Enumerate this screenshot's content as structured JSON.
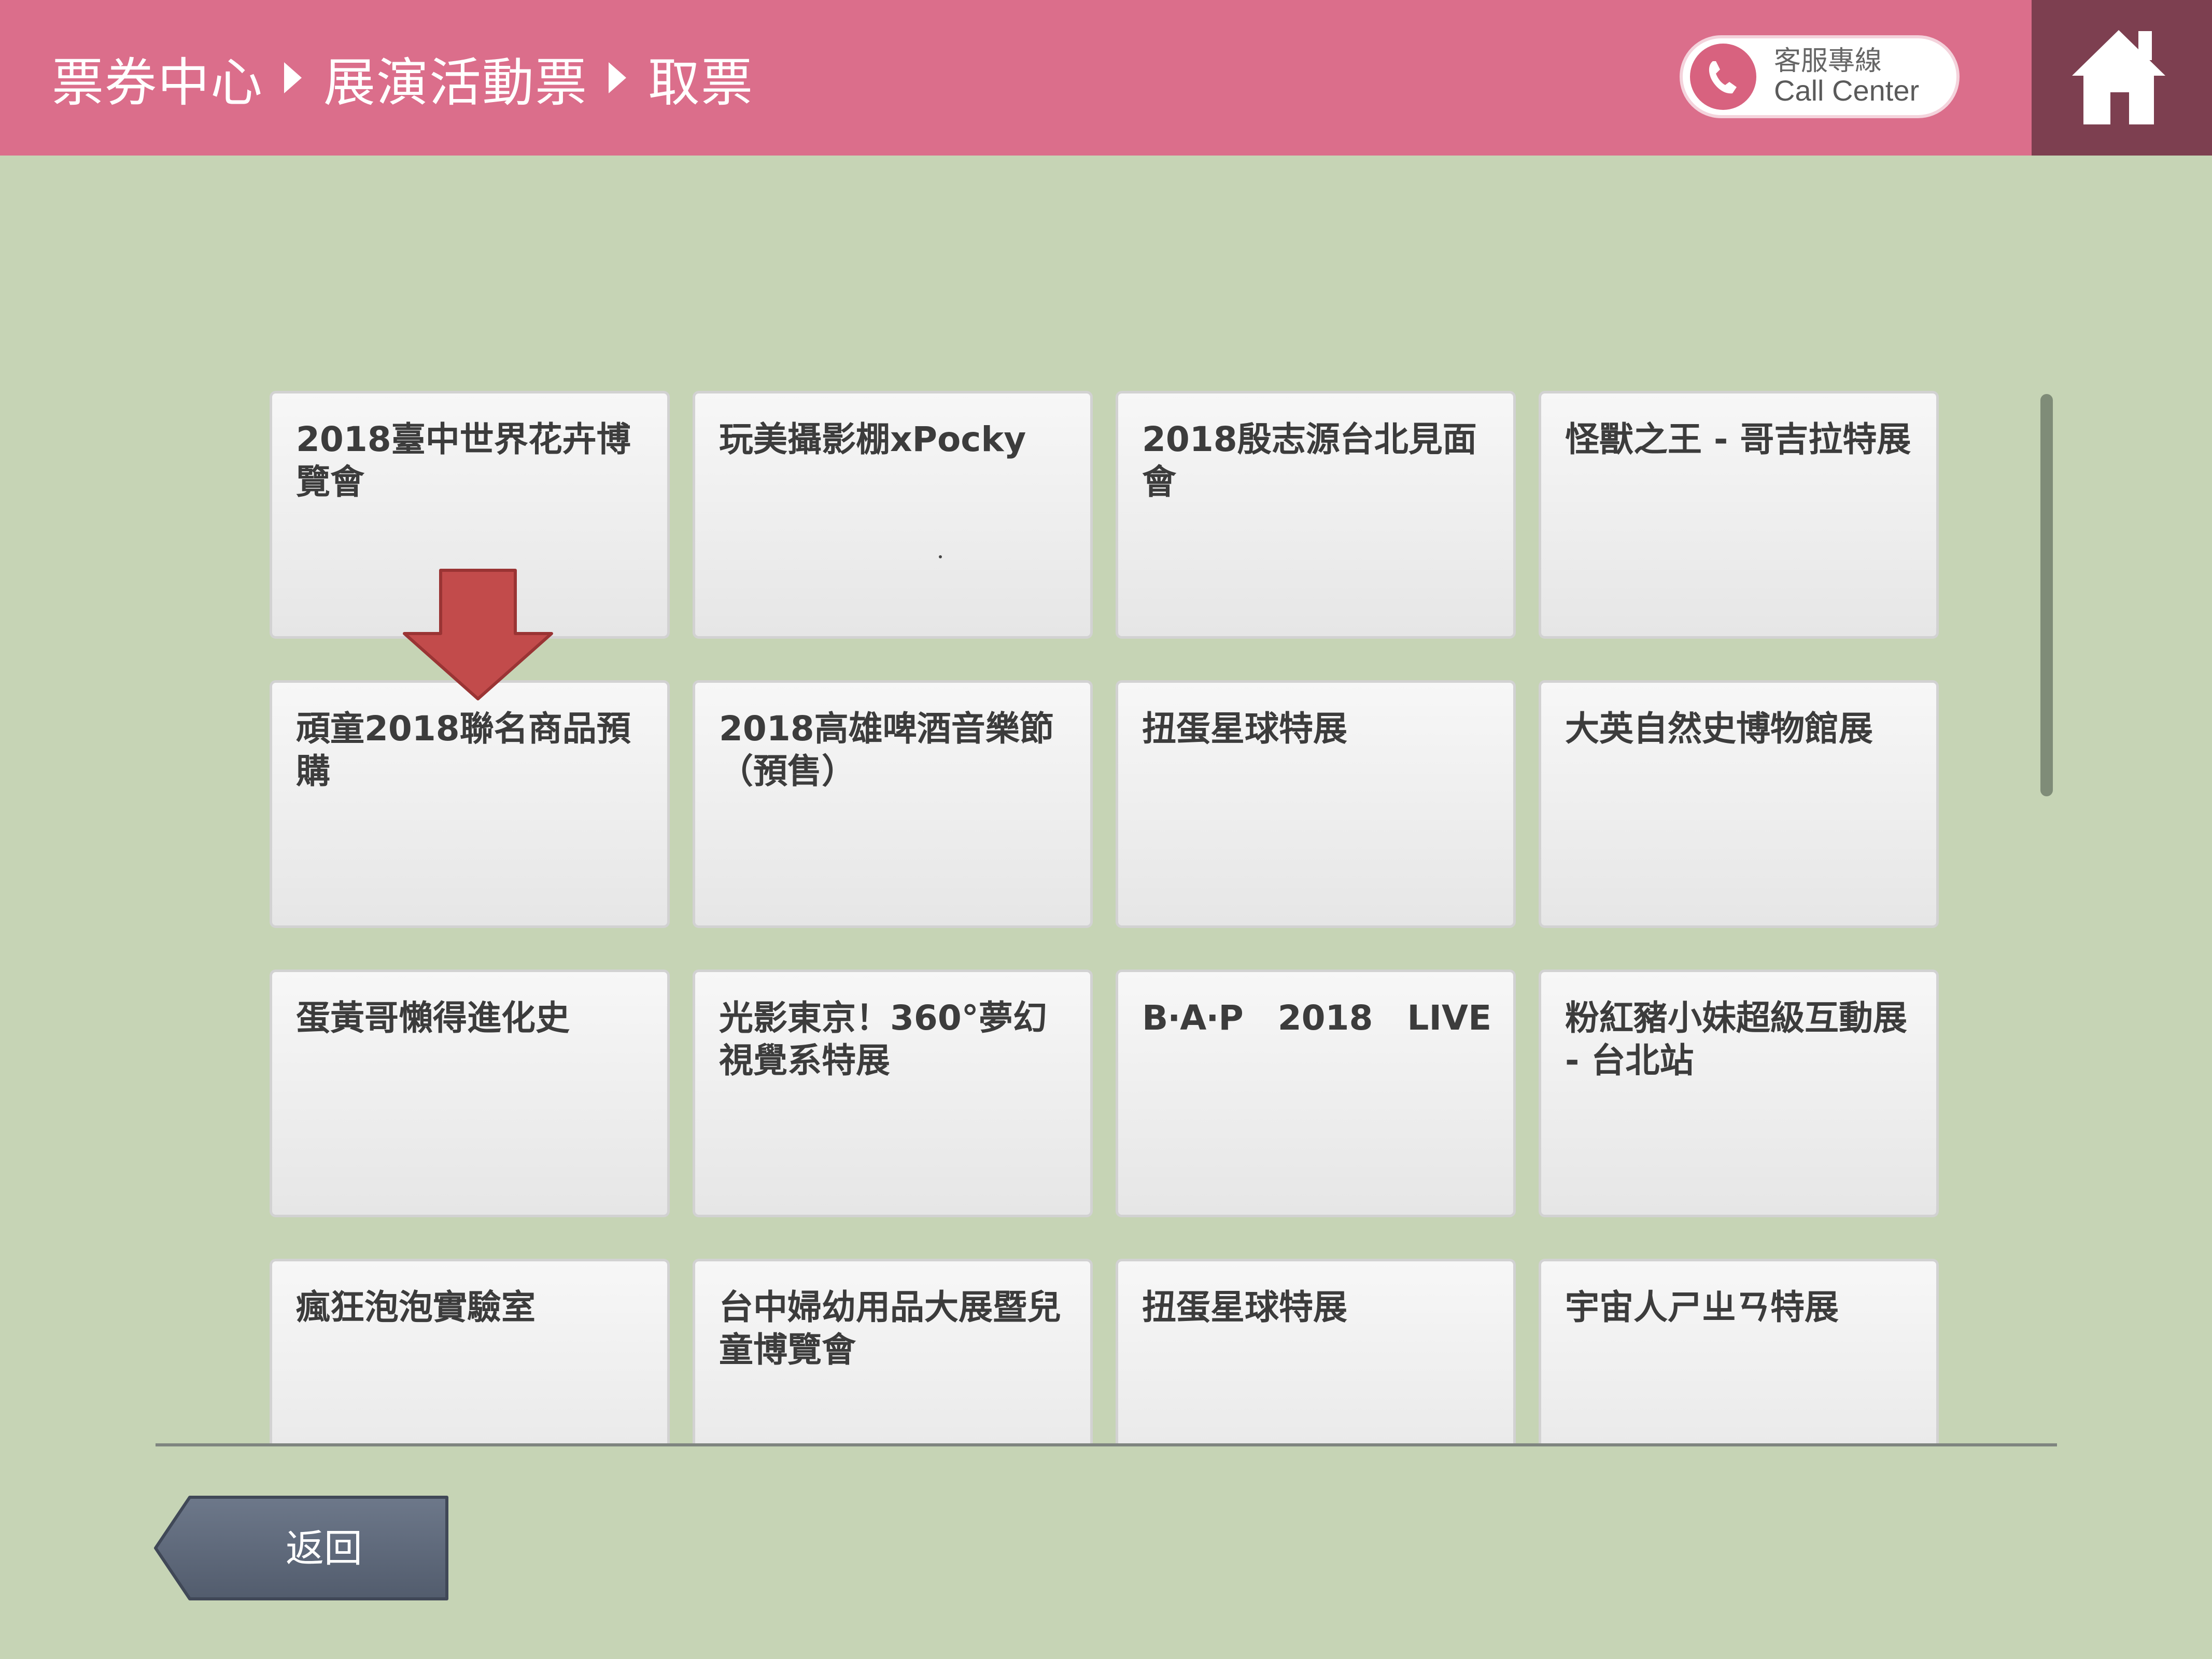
{
  "header": {
    "breadcrumb": [
      "票券中心",
      "展演活動票",
      "取票"
    ],
    "call_center": {
      "label_zh": "客服專線",
      "label_en": "Call Center",
      "icon": "phone-icon"
    },
    "home_icon": "home-icon",
    "colors": {
      "header_bg": "#db6e8b",
      "home_bg": "#7d3f50",
      "page_bg": "#c6d4b5"
    }
  },
  "events": [
    [
      "2018臺中世界花卉博覽會",
      "玩美攝影棚xPocky",
      "2018殷志源台北見面會",
      "怪獸之王 - 哥吉拉特展"
    ],
    [
      "頑童2018聯名商品預購",
      "2018高雄啤酒音樂節（預售）",
      "扭蛋星球特展",
      "大英自然史博物館展"
    ],
    [
      "蛋黃哥懶得進化史",
      "光影東京！360°夢幻視覺系特展",
      "B‧A‧P　2018　LIVE",
      "粉紅豬小妹超級互動展 - 台北站"
    ],
    [
      "瘋狂泡泡實驗室",
      "台中婦幼用品大展暨兒童博覽會",
      "扭蛋星球特展",
      "宇宙人ㄕㄓㄢ特展"
    ]
  ],
  "pointer": {
    "icon": "down-arrow-icon",
    "color": "#c24b4b"
  },
  "footer": {
    "back_label": "返回",
    "back_color": "#5f6a7d"
  }
}
